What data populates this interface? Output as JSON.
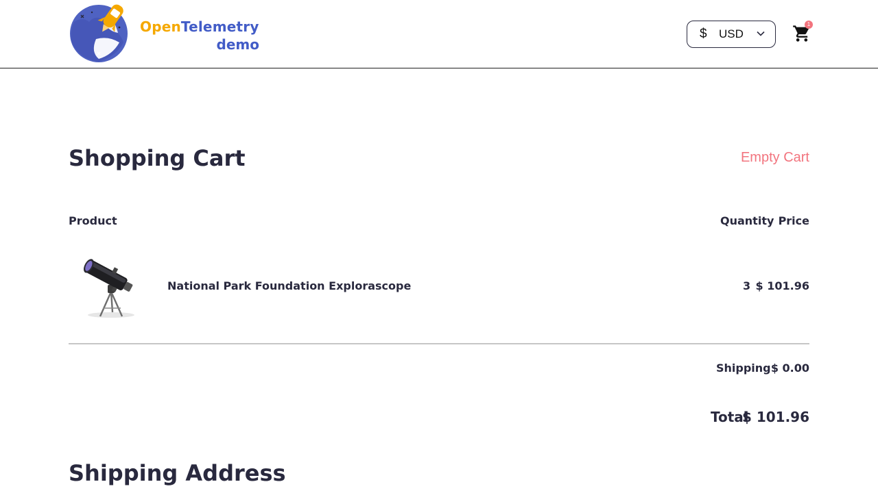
{
  "header": {
    "logo": {
      "line1_part1": "Open",
      "line1_part2": "Telemetry",
      "line2": "demo",
      "colors": {
        "orange": "#f5a800",
        "blue": "#425cc7"
      }
    },
    "currency": {
      "symbol": "$",
      "code": "USD",
      "icon": "chevron-down-icon"
    },
    "cart": {
      "icon": "shopping-cart-icon",
      "badge_count": "1",
      "badge_color": "#f2747e"
    }
  },
  "cart_page": {
    "title": "Shopping Cart",
    "empty_cart_label": "Empty Cart",
    "columns": {
      "product": "Product",
      "quantity": "Quantity",
      "price": "Price"
    },
    "items": [
      {
        "name": "National Park Foundation Explorascope",
        "quantity": "3",
        "price": "$ 101.96",
        "image": "telescope-image"
      }
    ],
    "shipping_label": "Shipping",
    "shipping_value": "$ 0.00",
    "total_label": "Total",
    "total_value": "$ 101.96"
  },
  "shipping_section": {
    "title": "Shipping Address"
  },
  "colors": {
    "text": "#29293e",
    "accent": "#f2747e",
    "divider": "#c6c6c6"
  }
}
